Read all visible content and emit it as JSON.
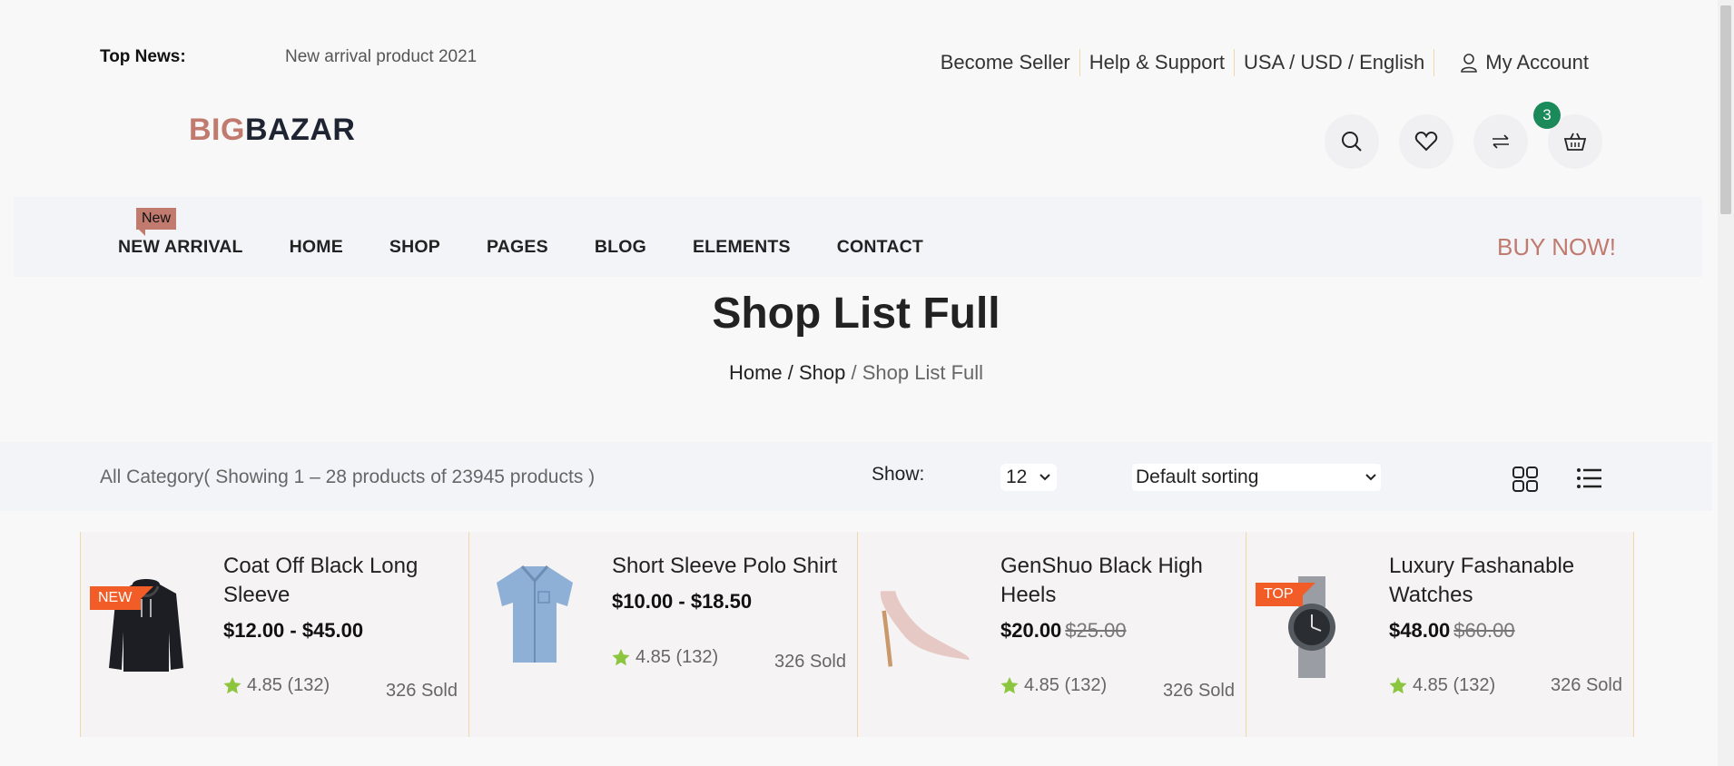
{
  "topbar": {
    "news_label": "Top News:",
    "news_text": "New arrival product 2021",
    "links": [
      "Become Seller",
      "Help & Support",
      "USA / USD / English"
    ],
    "account_label": "My Account"
  },
  "logo": {
    "part1": "BIG",
    "part2": "BAZAR"
  },
  "header_icons": {
    "cart_count": "3"
  },
  "nav": {
    "items": [
      "NEW ARRIVAL",
      "HOME",
      "SHOP",
      "PAGES",
      "BLOG",
      "ELEMENTS",
      "CONTACT"
    ],
    "new_tag": "New",
    "buy_now": "BUY NOW!"
  },
  "page": {
    "title": "Shop List Full",
    "breadcrumb": {
      "home": "Home",
      "sep1": " / ",
      "shop": "Shop",
      "sep2": " / ",
      "current": "Shop List Full"
    }
  },
  "toolbar": {
    "showing": "All Category( Showing 1 – 28 products of 23945 products )",
    "show_label": "Show:",
    "show_value": "12",
    "sort_value": "Default sorting"
  },
  "products": [
    {
      "name": "Coat Off Black Long Sleeve",
      "price": "$12.00 - $45.00",
      "old_price": "",
      "rating": "4.85 (132)",
      "sold": "326 Sold",
      "tag": "NEW"
    },
    {
      "name": "Short Sleeve Polo Shirt",
      "price": "$10.00 - $18.50",
      "old_price": "",
      "rating": "4.85 (132)",
      "sold": "326 Sold",
      "tag": ""
    },
    {
      "name": "GenShuo Black High Heels",
      "price": "$20.00",
      "old_price": "$25.00",
      "rating": "4.85 (132)",
      "sold": "326 Sold",
      "tag": ""
    },
    {
      "name": "Luxury Fashanable Watches",
      "price": "$48.00",
      "old_price": "$60.00",
      "rating": "4.85 (132)",
      "sold": "326 Sold",
      "tag": "TOP"
    }
  ],
  "colors": {
    "accent": "#c07a6e",
    "badge": "#1a8a5a",
    "tag": "#f25c27",
    "star": "#8cc63f"
  }
}
